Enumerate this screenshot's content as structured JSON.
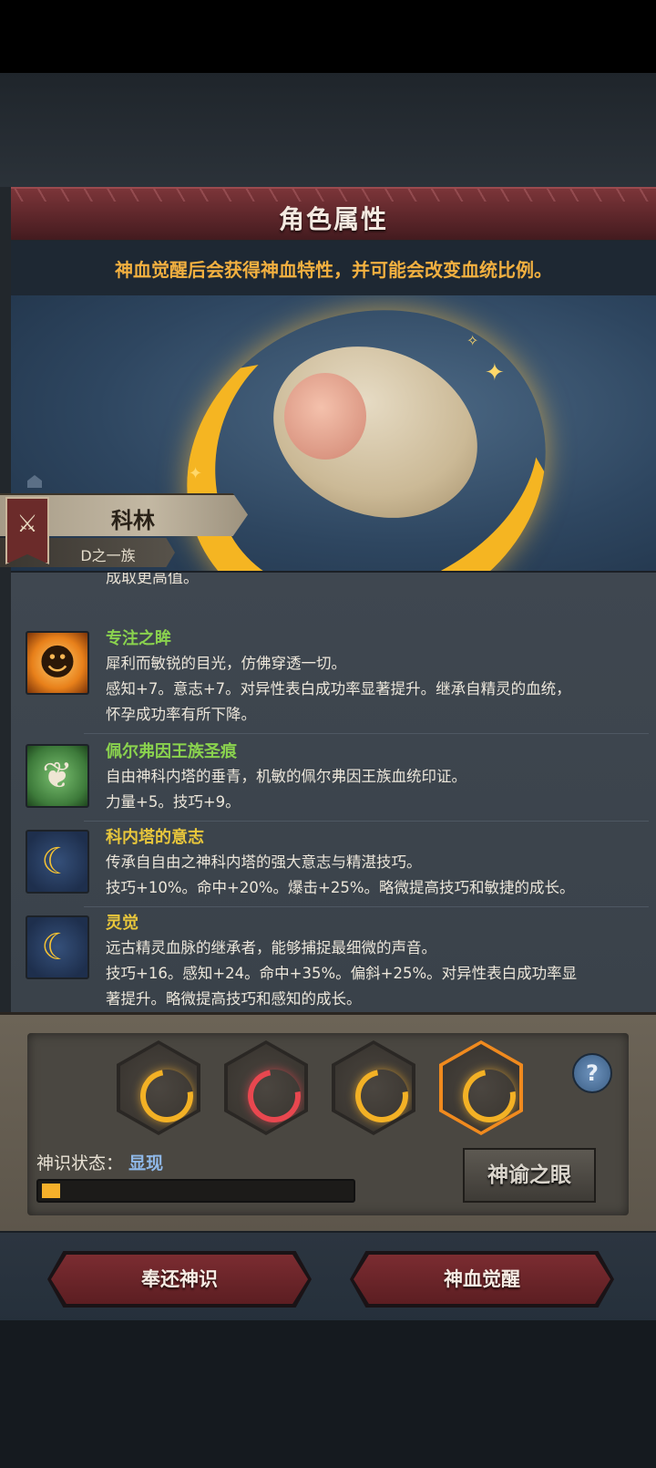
{
  "header": {
    "title": "角色属性"
  },
  "notice": {
    "text": "神血觉醒后会获得神血特性，并可能会改变血统比例。"
  },
  "character": {
    "name": "科林",
    "clan": "D之一族"
  },
  "traits": {
    "truncated_tail": "成取更高值。",
    "items": [
      {
        "name": "专注之眸",
        "icon": "smiling-sun-icon",
        "desc1": "犀利而敏锐的目光，仿佛穿透一切。",
        "desc2": "感知+7。意志+7。对异性表白成功率显著提升。继承自精灵的血统，",
        "desc3": "怀孕成功率有所下降。"
      },
      {
        "name": "佩尔弗因王族圣痕",
        "icon": "feather-icon",
        "desc1": "自由神科内塔的垂青，机敏的佩尔弗因王族血统印证。",
        "desc2": "力量+5。技巧+9。"
      },
      {
        "name": "科内塔的意志",
        "icon": "crescent-moon-icon",
        "desc1": "传承自自由之神科内塔的强大意志与精湛技巧。",
        "desc2": "技巧+10%。命中+20%。爆击+25%。略微提高技巧和敏捷的成长。"
      },
      {
        "name": "灵觉",
        "icon": "crescent-moon-icon",
        "desc1": "远古精灵血脉的继承者，能够捕捉最细微的声音。",
        "desc2": "技巧+16。感知+24。命中+35%。偏斜+25%。对异性表白成功率显",
        "desc3": "著提升。略微提高技巧和感知的成长。"
      }
    ]
  },
  "divine": {
    "status_label": "神识状态：",
    "status_value": "显现",
    "progress_fraction": 0.06,
    "oracle_button": "神谕之眼",
    "help_symbol": "?",
    "sockets": [
      {
        "icon": "gold-ring-icon",
        "color": "#f3b125",
        "selected": false
      },
      {
        "icon": "red-ring-icon",
        "color": "#e8474f",
        "selected": false
      },
      {
        "icon": "gold-ring-icon",
        "color": "#f3b125",
        "selected": false
      },
      {
        "icon": "gold-ring-icon",
        "color": "#f3b125",
        "selected": true
      }
    ]
  },
  "actions": {
    "return_label": "奉还神识",
    "awaken_label": "神血觉醒"
  },
  "colors": {
    "accent_orange": "#f2b040",
    "trait_green": "#8ad24e",
    "trait_yellow": "#e8c63b",
    "button_red": "#7b2c31"
  }
}
